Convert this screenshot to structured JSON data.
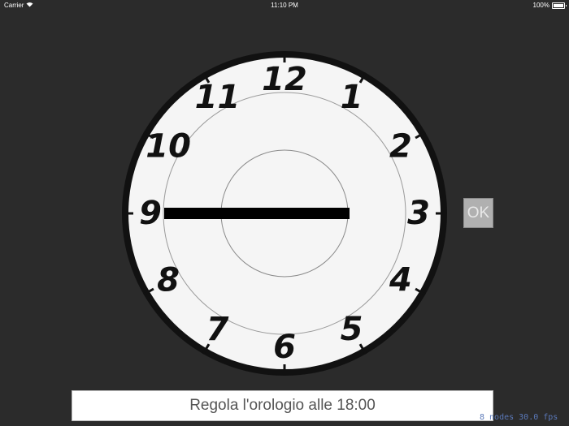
{
  "status_bar": {
    "carrier": "Carrier",
    "time": "11:10 PM",
    "battery": "100%"
  },
  "clock": {
    "numerals": [
      "12",
      "1",
      "2",
      "3",
      "4",
      "5",
      "6",
      "7",
      "8",
      "9",
      "10",
      "11"
    ],
    "hour_hand_value": 9.0,
    "minute_hand_value": 15,
    "colors": {
      "face": "#f5f5f5",
      "rim": "#111111",
      "hand": "#000000",
      "background": "#2b2b2b"
    }
  },
  "ok_button": {
    "label": "OK"
  },
  "instruction": {
    "text": "Regola l'orologio alle 18:00"
  },
  "debug": {
    "text": "8 nodes 30.0 fps"
  }
}
